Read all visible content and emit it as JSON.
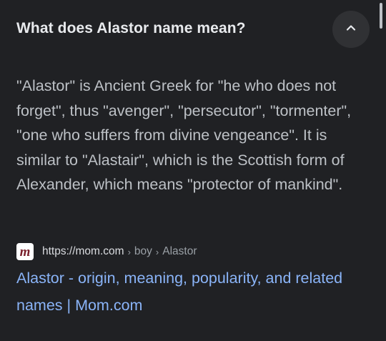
{
  "question": {
    "text": "What does Alastor name mean?",
    "toggle_icon": "chevron-up-icon"
  },
  "answer": {
    "text": "\"Alastor\" is Ancient Greek for \"he who does not forget\", thus \"avenger\", \"persecutor\", \"tormenter\", \"one who suffers from divine vengeance\". It is similar to \"Alastair\", which is the Scottish form of Alexander, which means \"protector of mankind\"."
  },
  "source": {
    "favicon_letter": "m",
    "url": "https://mom.com",
    "breadcrumbs": [
      "boy",
      "Alastor"
    ],
    "separator": "›",
    "title": "Alastor - origin, meaning, popularity, and related names | Mom.com"
  },
  "colors": {
    "background": "#202124",
    "question_text": "#e8eaed",
    "answer_text": "#bdc1c6",
    "link": "#8ab4f8",
    "button_bg": "#303134",
    "favicon_letter": "#7a1f2b"
  }
}
